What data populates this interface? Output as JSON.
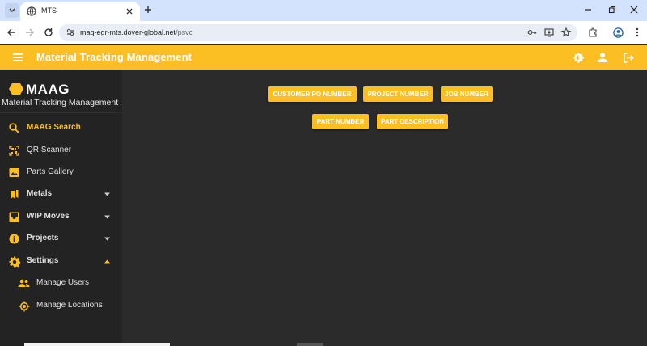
{
  "browser": {
    "tab_title": "MTS",
    "url_host": "mag-egr-mts.dover-global.net",
    "url_path": "/psvc"
  },
  "app": {
    "title": "Material Tracking Management",
    "accent_color": "#fbbf24"
  },
  "sidebar": {
    "brand_name": "MAAG",
    "brand_subtitle": "Material Tracking Management",
    "items": [
      {
        "label": "MAAG Search",
        "icon": "search-icon",
        "active": true
      },
      {
        "label": "QR Scanner",
        "icon": "qr-code-icon"
      },
      {
        "label": "Parts Gallery",
        "icon": "image-icon"
      },
      {
        "label": "Metals",
        "icon": "bookmarks-icon",
        "expandable": true
      },
      {
        "label": "WIP Moves",
        "icon": "inbox-icon",
        "expandable": true
      },
      {
        "label": "Projects",
        "icon": "info-icon",
        "expandable": true
      },
      {
        "label": "Settings",
        "icon": "gear-icon",
        "expandable": true,
        "expanded": true
      },
      {
        "label": "Manage Users",
        "icon": "group-icon"
      },
      {
        "label": "Manage Locations",
        "icon": "location-icon"
      }
    ]
  },
  "main": {
    "buttons": [
      "CUSTOMER PO NUMBER",
      "PROJECT NUMBER",
      "JOB NUMBER",
      "PART NUMBER",
      "PART DESCRIPTION"
    ]
  }
}
